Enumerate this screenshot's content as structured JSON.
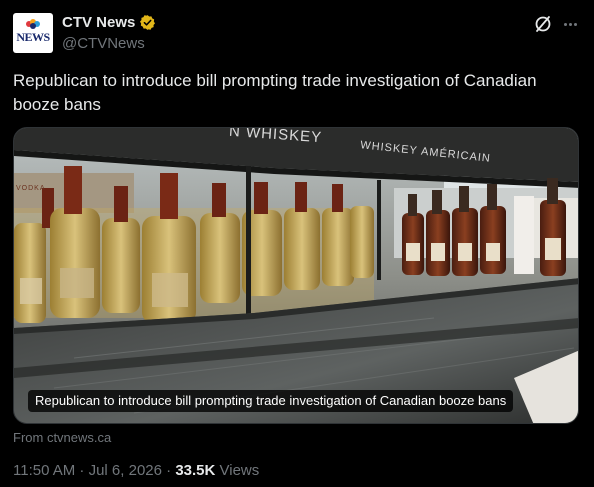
{
  "account": {
    "display_name": "CTV News",
    "handle": "@CTVNews",
    "avatar_text": "NEWS",
    "verified_color": "#e2b719"
  },
  "tweet": {
    "text": "Republican to introduce bill prompting trade investigation of Canadian booze bans"
  },
  "media": {
    "caption": "Republican to introduce bill prompting trade investigation of Canadian booze bans",
    "sign_left": "N WHISKEY",
    "sign_right": "WHISKEY AMÉRICAIN",
    "sign_small": "VODKA"
  },
  "link": {
    "source": "From ctvnews.ca"
  },
  "meta": {
    "time": "11:50 AM · Jul 6, 2026 · ",
    "views_count": "33.5K",
    "views_label": " Views"
  }
}
